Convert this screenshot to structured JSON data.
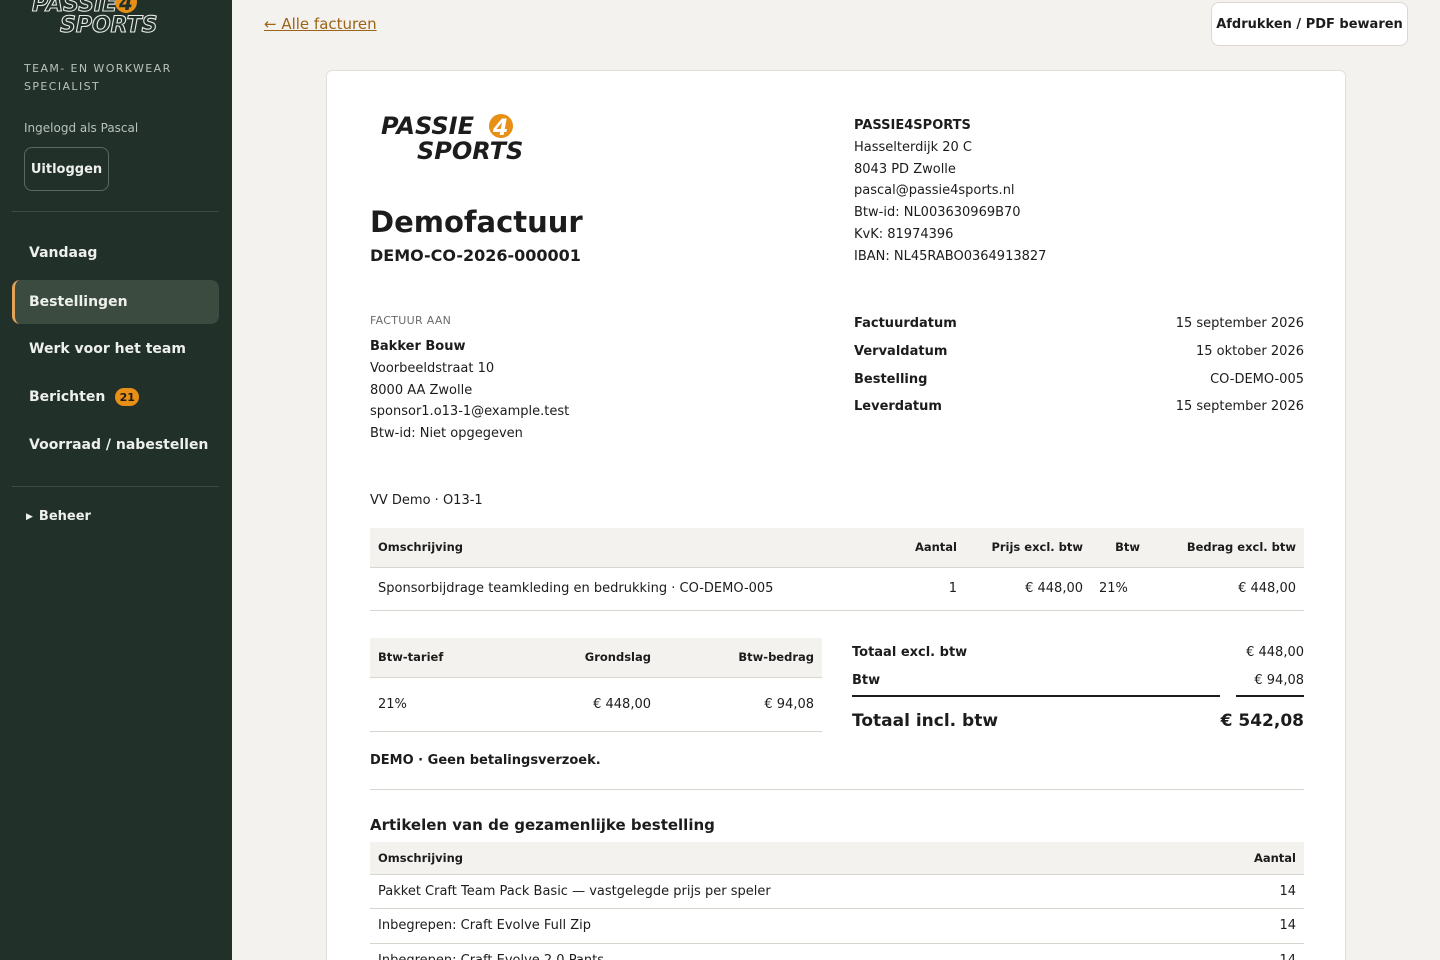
{
  "brand": {
    "logo_line1": "PASSIE",
    "logo_digit": "4",
    "logo_line2": "SPORTS",
    "logo_dark": "#1c1c1c",
    "logo_orange": "#e88f16"
  },
  "sidebar": {
    "tagline": "TEAM- EN WORKWEAR SPECIALIST",
    "logged_in": "Ingelogd als Pascal",
    "logout_label": "Uitloggen",
    "items": [
      {
        "label": "Vandaag",
        "active": false
      },
      {
        "label": "Bestellingen",
        "active": true
      },
      {
        "label": "Werk voor het team",
        "active": false
      },
      {
        "label": "Berichten",
        "active": false,
        "badge": "21"
      },
      {
        "label": "Voorraad / nabestellen",
        "active": false
      }
    ],
    "beheer_label": "Beheer",
    "beheer_icon": "triangle-right-icon"
  },
  "toolbar": {
    "back_label": "← Alle facturen",
    "print_label": "Afdrukken / PDF bewaren"
  },
  "invoice": {
    "title": "Demofactuur",
    "number": "DEMO-CO-2026-000001",
    "seller": {
      "name": "PASSIE4SPORTS",
      "street": "Hasselterdijk 20 C",
      "city": "8043 PD Zwolle",
      "email": "pascal@passie4sports.nl",
      "vat": "Btw-id: NL003630969B70",
      "kvk": "KvK: 81974396",
      "iban": "IBAN: NL45RABO0364913827"
    },
    "to_label": "FACTUUR AAN",
    "buyer": {
      "name": "Bakker Bouw",
      "street": "Voorbeeldstraat 10",
      "city": "8000 AA Zwolle",
      "email": "sponsor1.o13-1@example.test",
      "vat": "Btw-id: Niet opgegeven"
    },
    "meta": [
      {
        "label": "Factuurdatum",
        "value": "15 september 2026"
      },
      {
        "label": "Vervaldatum",
        "value": "15 oktober 2026"
      },
      {
        "label": "Bestelling",
        "value": "CO-DEMO-005"
      },
      {
        "label": "Leverdatum",
        "value": "15 september 2026"
      }
    ],
    "reference": "VV Demo · O13-1",
    "lines": {
      "headers": [
        "Omschrijving",
        "Aantal",
        "Prijs excl. btw",
        "Btw",
        "Bedrag excl. btw"
      ],
      "rows": [
        [
          "Sponsorbijdrage teamkleding en bedrukking · CO-DEMO-005",
          "1",
          "€ 448,00",
          "21%",
          "€ 448,00"
        ]
      ]
    },
    "vat_table": {
      "headers": [
        "Btw-tarief",
        "Grondslag",
        "Btw-bedrag"
      ],
      "rows": [
        [
          "21%",
          "€ 448,00",
          "€ 94,08"
        ]
      ]
    },
    "totals": {
      "excl_label": "Totaal excl. btw",
      "excl_value": "€ 448,00",
      "vat_label": "Btw",
      "vat_value": "€ 94,08",
      "incl_label": "Totaal incl. btw",
      "incl_value": "€ 542,08"
    },
    "demo_note": "DEMO · Geen betalingsverzoek.",
    "articles_title": "Artikelen van de gezamenlijke bestelling",
    "articles": {
      "headers": [
        "Omschrijving",
        "Aantal"
      ],
      "rows": [
        [
          "Pakket Craft Team Pack Basic — vastgelegde prijs per speler",
          "14"
        ],
        [
          "Inbegrepen: Craft Evolve Full Zip",
          "14"
        ],
        [
          "Inbegrepen: Craft Evolve 2.0 Pants",
          "14"
        ]
      ]
    }
  }
}
